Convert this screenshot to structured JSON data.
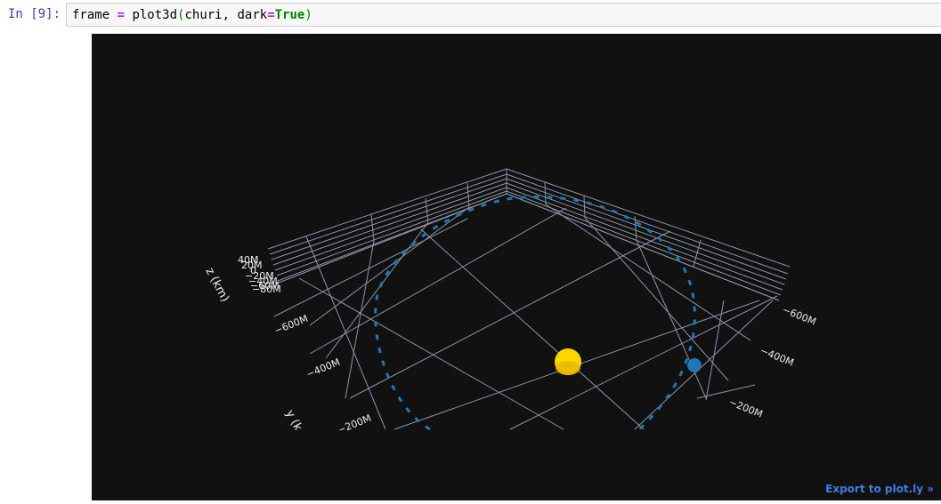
{
  "cell": {
    "prompt": "In [9]:",
    "code": {
      "var": "frame ",
      "eq": "=",
      "call": " plot3d",
      "open": "(",
      "args": "churi, dark",
      "eq2": "=",
      "kw_true": "True",
      "close": ")"
    }
  },
  "plot": {
    "background": "#111111",
    "grid_color": "#aab4c8",
    "export_label": "Export to plot.ly »",
    "z_axis": {
      "title": "z (km)",
      "ticks": [
        "40M",
        "20M",
        "0",
        "−20M",
        "−40M",
        "−60M",
        "−80M"
      ]
    },
    "y_axis": {
      "title": "y (k",
      "ticks": [
        "−600M",
        "−400M",
        "−200M"
      ]
    },
    "x_axis": {
      "ticks": [
        "−600M",
        "−400M",
        "−200M"
      ]
    },
    "bodies": [
      {
        "name": "sun-sphere",
        "color": "#ffd500"
      },
      {
        "name": "planet-sphere",
        "color": "#1f77b4"
      }
    ],
    "trajectory_color": "#1f77b4"
  }
}
